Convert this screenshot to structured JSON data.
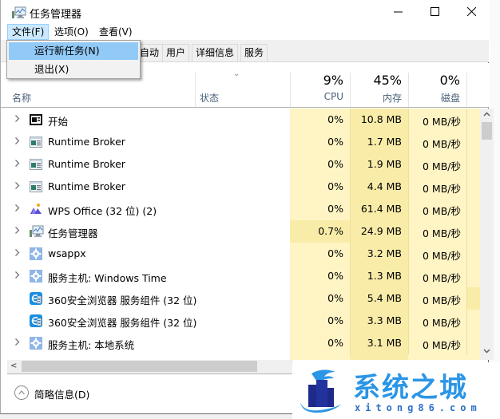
{
  "window": {
    "title": "任务管理器",
    "controls": {
      "minimize": "—",
      "maximize": "☐",
      "close": "✕"
    }
  },
  "menubar": {
    "items": [
      {
        "label": "文件(F)",
        "active": true
      },
      {
        "label": "选项(O)"
      },
      {
        "label": "查看(V)"
      }
    ]
  },
  "file_menu": {
    "items": [
      {
        "label": "运行新任务(N)",
        "highlighted": true
      },
      {
        "label": "退出(X)"
      }
    ]
  },
  "tabs": [
    {
      "label": "启动",
      "partial_visible": "自动"
    },
    {
      "label": "用户"
    },
    {
      "label": "详细信息"
    },
    {
      "label": "服务"
    }
  ],
  "header": {
    "sort_indicator": "⌄",
    "name_label": "名称",
    "status_label": "状态",
    "cpu": {
      "percent": "9%",
      "label": "CPU"
    },
    "memory": {
      "percent": "45%",
      "label": "内存"
    },
    "disk": {
      "percent": "0%",
      "label": "磁盘"
    }
  },
  "processes": [
    {
      "name": "开始",
      "icon": "start-window-icon",
      "expandable": true,
      "cpu": "0%",
      "memory": "10.8 MB",
      "disk": "0 MB/秒"
    },
    {
      "name": "Runtime Broker",
      "icon": "app-window-icon",
      "expandable": true,
      "cpu": "0%",
      "memory": "1.7 MB",
      "disk": "0 MB/秒"
    },
    {
      "name": "Runtime Broker",
      "icon": "app-window-icon",
      "expandable": true,
      "cpu": "0%",
      "memory": "1.9 MB",
      "disk": "0 MB/秒"
    },
    {
      "name": "Runtime Broker",
      "icon": "app-window-icon",
      "expandable": true,
      "cpu": "0%",
      "memory": "4.4 MB",
      "disk": "0 MB/秒"
    },
    {
      "name": "WPS Office (32 位) (2)",
      "icon": "wps-icon",
      "expandable": true,
      "cpu": "0%",
      "memory": "61.4 MB",
      "disk": "0 MB/秒"
    },
    {
      "name": "任务管理器",
      "icon": "task-manager-icon",
      "expandable": true,
      "cpu": "0.7%",
      "memory": "24.9 MB",
      "disk": "0 MB/秒",
      "cpu_highlight": true
    },
    {
      "name": "wsappx",
      "icon": "gear-icon",
      "expandable": true,
      "cpu": "0%",
      "memory": "3.2 MB",
      "disk": "0 MB/秒"
    },
    {
      "name": "服务主机: Windows Time",
      "icon": "gear-icon",
      "expandable": true,
      "cpu": "0%",
      "memory": "1.3 MB",
      "disk": "0 MB/秒"
    },
    {
      "name": "360安全浏览器 服务组件 (32 位)",
      "icon": "browser-360-icon",
      "expandable": false,
      "cpu": "0%",
      "memory": "5.4 MB",
      "disk": "0 MB/秒",
      "net_highlight": true
    },
    {
      "name": "360安全浏览器 服务组件 (32 位)",
      "icon": "browser-360-icon",
      "expandable": false,
      "cpu": "0%",
      "memory": "3.3 MB",
      "disk": "0 MB/秒"
    },
    {
      "name": "服务主机: 本地系统",
      "icon": "gear-icon",
      "expandable": true,
      "cpu": "0%",
      "memory": "3.1 MB",
      "disk": "0 MB/秒"
    }
  ],
  "scrollbars": {
    "vertical": {
      "up": "⌃",
      "down": "⌄"
    },
    "horizontal": {
      "left": "<"
    }
  },
  "footer": {
    "fewer_details_label": "简略信息(D)",
    "fewer_details_icon": "^"
  },
  "watermark": {
    "title": "系统之城",
    "subtitle": "xitong86.com"
  },
  "colors": {
    "menu_highlight": "#91c9f7",
    "menu_active": "#cce8ff",
    "heat_low": "#fff4c4",
    "heat_mid": "#f9eca8",
    "header_label": "#4c607a",
    "watermark_blue": "#2b95e6"
  }
}
